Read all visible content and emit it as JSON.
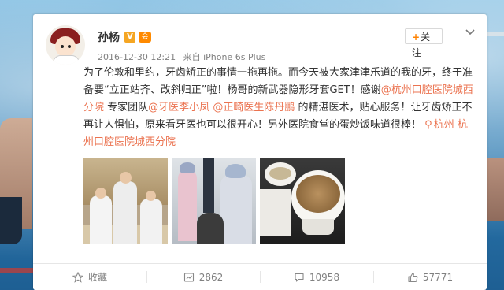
{
  "post": {
    "author_name": "孙杨",
    "vip_badge": "V",
    "member_badge": "会",
    "follow_label": "关注",
    "follow_plus": "+",
    "timestamp": "2016-12-30 12:21",
    "source": "来自 iPhone 6s Plus",
    "text_part1": "为了伦敦和里约，牙齿矫正的事情一拖再拖。而今天被大家津津乐道的我的牙，终于准备要“立正站齐、改斜归正”啦！杨哥的新武器隐形牙套GET！感谢",
    "mention_hospital": "@杭州口腔医院城西分院",
    "text_part2": " 专家团队",
    "mention_doctor1": "@牙医李小凤",
    "text_part3": " ",
    "mention_doctor2": "@正畸医生陈丹鹏",
    "text_part4": " 的精湛医术，贴心服务！让牙齿矫正不再让人惧怕，原来看牙医也可以很开心！另外医院食堂的蛋炒饭味道很棒！",
    "location": "杭州 杭州口腔医院城西分院"
  },
  "actions": {
    "favorite_label": "收藏",
    "repost_count": "2862",
    "comment_count": "10958",
    "like_count": "57771"
  },
  "icons": {
    "favorite": "star-icon",
    "repost": "repost-icon",
    "comment": "comment-icon",
    "like": "thumbs-up-icon",
    "location": "location-pin-icon",
    "menu": "chevron-down-icon"
  },
  "colors": {
    "link": "#eb7350",
    "accent": "#ff8200"
  }
}
